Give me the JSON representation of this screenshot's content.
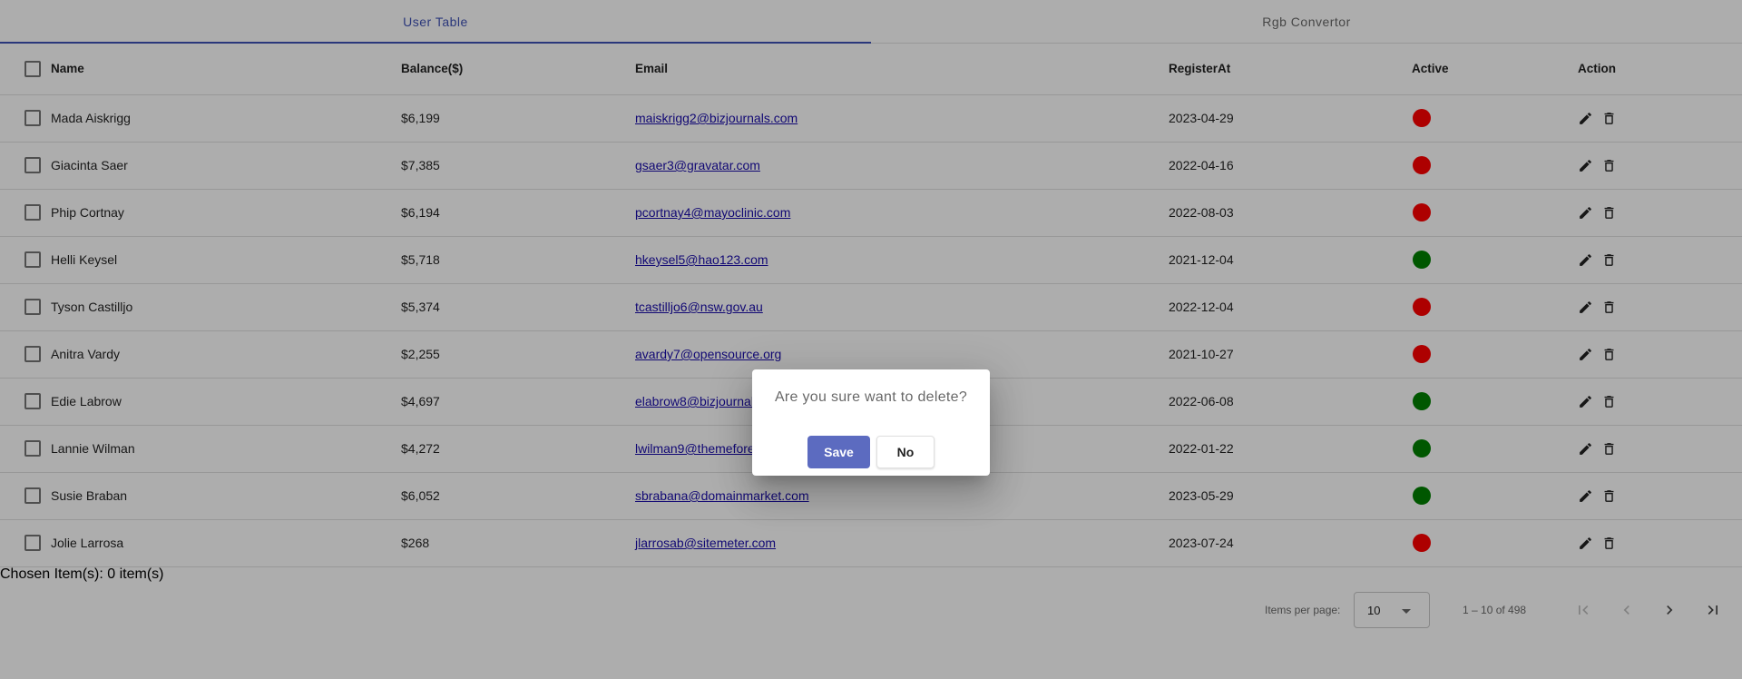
{
  "tabs": [
    {
      "label": "User Table",
      "active": true
    },
    {
      "label": "Rgb Convertor",
      "active": false
    }
  ],
  "table": {
    "columns": [
      "Name",
      "Balance($)",
      "Email",
      "RegisterAt",
      "Active",
      "Action"
    ],
    "rows": [
      {
        "name": "Mada Aiskrigg",
        "balance": "$6,199",
        "email": "maiskrigg2@bizjournals.com",
        "registered": "2023-04-29",
        "active": false
      },
      {
        "name": "Giacinta Saer",
        "balance": "$7,385",
        "email": "gsaer3@gravatar.com",
        "registered": "2022-04-16",
        "active": false
      },
      {
        "name": "Phip Cortnay",
        "balance": "$6,194",
        "email": "pcortnay4@mayoclinic.com",
        "registered": "2022-08-03",
        "active": false
      },
      {
        "name": "Helli Keysel",
        "balance": "$5,718",
        "email": "hkeysel5@hao123.com",
        "registered": "2021-12-04",
        "active": true
      },
      {
        "name": "Tyson Castilljo",
        "balance": "$5,374",
        "email": "tcastilljo6@nsw.gov.au",
        "registered": "2022-12-04",
        "active": false
      },
      {
        "name": "Anitra Vardy",
        "balance": "$2,255",
        "email": "avardy7@opensource.org",
        "registered": "2021-10-27",
        "active": false
      },
      {
        "name": "Edie Labrow",
        "balance": "$4,697",
        "email": "elabrow8@bizjournals.com",
        "registered": "2022-06-08",
        "active": true
      },
      {
        "name": "Lannie Wilman",
        "balance": "$4,272",
        "email": "lwilman9@themeforest.net",
        "registered": "2022-01-22",
        "active": true
      },
      {
        "name": "Susie Braban",
        "balance": "$6,052",
        "email": "sbrabana@domainmarket.com",
        "registered": "2023-05-29",
        "active": true
      },
      {
        "name": "Jolie Larrosa",
        "balance": "$268",
        "email": "jlarrosab@sitemeter.com",
        "registered": "2023-07-24",
        "active": false
      }
    ]
  },
  "chosen_text": "Chosen Item(s): 0 item(s)",
  "paginator": {
    "items_per_page_label": "Items per page:",
    "page_size": "10",
    "range_label": "1 – 10 of 498"
  },
  "dialog": {
    "message": "Are you sure want to delete?",
    "save_label": "Save",
    "no_label": "No"
  },
  "colors": {
    "accent": "#3f51b5",
    "active_true": "#008000",
    "active_false": "#ff0000",
    "dialog_save": "#5c6bc0"
  },
  "icons": {
    "edit": "pencil-icon",
    "delete": "trash-icon"
  }
}
